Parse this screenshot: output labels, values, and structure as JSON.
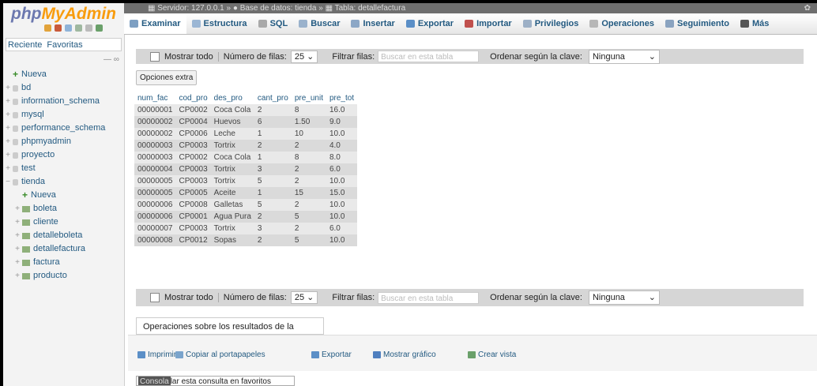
{
  "nav": {
    "logo_a": "php",
    "logo_b": "MyAdmin",
    "tabs": [
      "Reciente",
      "Favoritas"
    ],
    "collapse": "— ∞",
    "tree": [
      {
        "label": "Nueva",
        "kind": "new",
        "indent": 0
      },
      {
        "label": "bd",
        "kind": "db",
        "indent": 0
      },
      {
        "label": "information_schema",
        "kind": "db",
        "indent": 0
      },
      {
        "label": "mysql",
        "kind": "db",
        "indent": 0
      },
      {
        "label": "performance_schema",
        "kind": "db",
        "indent": 0
      },
      {
        "label": "phpmyadmin",
        "kind": "db",
        "indent": 0
      },
      {
        "label": "proyecto",
        "kind": "db",
        "indent": 0
      },
      {
        "label": "test",
        "kind": "db",
        "indent": 0
      },
      {
        "label": "tienda",
        "kind": "db",
        "indent": 0
      },
      {
        "label": "Nueva",
        "kind": "new",
        "indent": 1
      },
      {
        "label": "boleta",
        "kind": "table",
        "indent": 1
      },
      {
        "label": "cliente",
        "kind": "table",
        "indent": 1
      },
      {
        "label": "detalleboleta",
        "kind": "table",
        "indent": 1
      },
      {
        "label": "detallefactura",
        "kind": "table",
        "indent": 1
      },
      {
        "label": "factura",
        "kind": "table",
        "indent": 1
      },
      {
        "label": "producto",
        "kind": "table",
        "indent": 1
      }
    ]
  },
  "breadcrumb": {
    "server": "Servidor: 127.0.0.1",
    "database": "Base de datos: tienda",
    "table": "Tabla: detallefactura",
    "sep": "»"
  },
  "tabs": [
    {
      "label": "Examinar",
      "icon": "browse-icon",
      "color": "#7d9fc2"
    },
    {
      "label": "Estructura",
      "icon": "structure-icon",
      "color": "#9bb6d4"
    },
    {
      "label": "SQL",
      "icon": "sql-icon",
      "color": "#a9a9a9"
    },
    {
      "label": "Buscar",
      "icon": "search-icon",
      "color": "#9ab2cc"
    },
    {
      "label": "Insertar",
      "icon": "insert-icon",
      "color": "#8ca7c6"
    },
    {
      "label": "Exportar",
      "icon": "export-icon",
      "color": "#5b8fc7"
    },
    {
      "label": "Importar",
      "icon": "import-icon",
      "color": "#c0504d"
    },
    {
      "label": "Privilegios",
      "icon": "privileges-icon",
      "color": "#9db0c6"
    },
    {
      "label": "Operaciones",
      "icon": "operations-icon",
      "color": "#b7b7b7"
    },
    {
      "label": "Seguimiento",
      "icon": "tracking-icon",
      "color": "#8aa3c0"
    },
    {
      "label": "Más",
      "icon": "more-icon",
      "color": "#555555"
    }
  ],
  "controls": {
    "show_all": "Mostrar todo",
    "rows_label": "Número de filas:",
    "rows_value": "25",
    "filter_label": "Filtrar filas:",
    "filter_placeholder": "Buscar en esta tabla",
    "order_label": "Ordenar según la clave:",
    "order_value": "Ninguna"
  },
  "extra_options": "Opciones extra",
  "results": {
    "columns": [
      "num_fac",
      "cod_pro",
      "des_pro",
      "cant_pro",
      "pre_unit",
      "pre_tot"
    ],
    "rows": [
      [
        "00000001",
        "CP0002",
        "Coca Cola",
        "2",
        "8",
        "16.0"
      ],
      [
        "00000002",
        "CP0004",
        "Huevos",
        "6",
        "1.50",
        "9.0"
      ],
      [
        "00000002",
        "CP0006",
        "Leche",
        "1",
        "10",
        "10.0"
      ],
      [
        "00000003",
        "CP0003",
        "Tortrix",
        "2",
        "2",
        "4.0"
      ],
      [
        "00000003",
        "CP0002",
        "Coca Cola",
        "1",
        "8",
        "8.0"
      ],
      [
        "00000004",
        "CP0003",
        "Tortrix",
        "3",
        "2",
        "6.0"
      ],
      [
        "00000005",
        "CP0003",
        "Tortrix",
        "5",
        "2",
        "10.0"
      ],
      [
        "00000005",
        "CP0005",
        "Aceite",
        "1",
        "15",
        "15.0"
      ],
      [
        "00000006",
        "CP0008",
        "Galletas",
        "5",
        "2",
        "10.0"
      ],
      [
        "00000006",
        "CP0001",
        "Agua Pura",
        "2",
        "5",
        "10.0"
      ],
      [
        "00000007",
        "CP0003",
        "Tortrix",
        "3",
        "2",
        "6.0"
      ],
      [
        "00000008",
        "CP0012",
        "Sopas",
        "2",
        "5",
        "10.0"
      ]
    ]
  },
  "operations": {
    "title": "Operaciones sobre los resultados de la consulta",
    "buttons": [
      {
        "label": "Imprimir",
        "icon": "print-icon",
        "color": "#5b8fc7"
      },
      {
        "label": "Copiar al portapapeles",
        "icon": "clipboard-icon",
        "color": "#7aa4cc"
      },
      {
        "label": "Exportar",
        "icon": "export-icon",
        "color": "#5b8fc7"
      },
      {
        "label": "Mostrar gráfico",
        "icon": "chart-icon",
        "color": "#4f7fbf"
      },
      {
        "label": "Crear vista",
        "icon": "view-icon",
        "color": "#6aa06a"
      }
    ]
  },
  "console": {
    "label": "Consola",
    "overlap_text": "lar esta consulta en favoritos"
  }
}
